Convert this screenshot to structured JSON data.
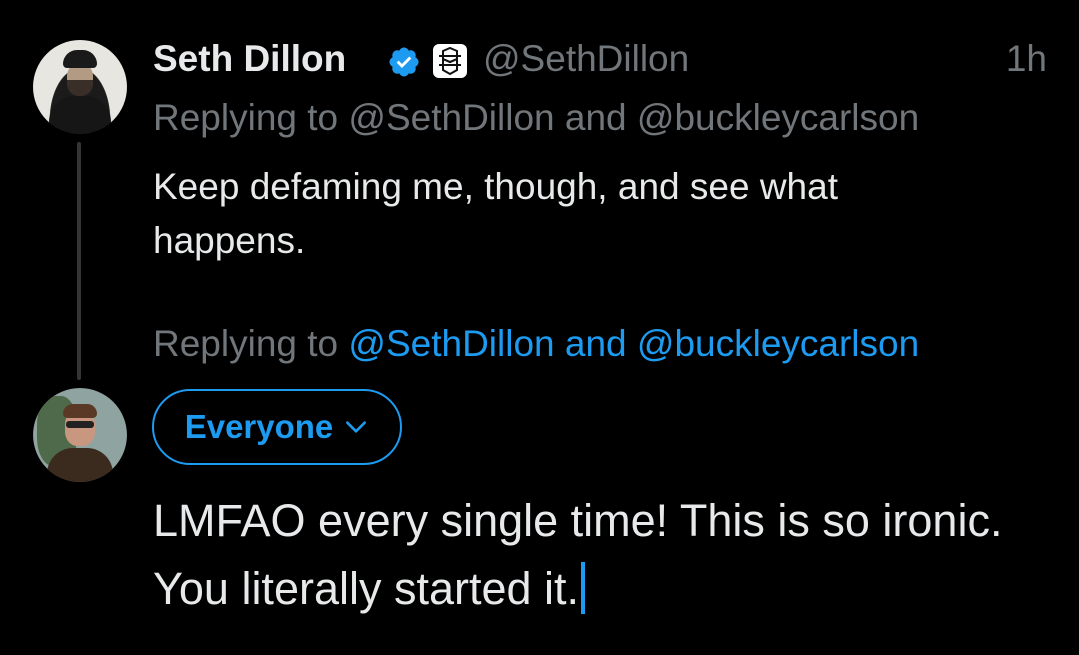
{
  "original_tweet": {
    "author_name": "Seth Dillon",
    "handle": "@SethDillon",
    "time": "1h",
    "replying_prefix": "Replying to",
    "replying_targets": "@SethDillon and @buckleycarlson",
    "text": "Keep defaming me, though, and see what happens."
  },
  "composer": {
    "replying_prefix": "Replying to",
    "replying_targets": "@SethDillon and @buckleycarlson",
    "audience_label": "Everyone",
    "draft_text": "LMFAO every single time! This is so ironic. You literally started it."
  },
  "icons": {
    "verified": "verified-badge-icon",
    "affiliate": "babylon-bee-affiliate-icon",
    "audience_chevron": "chevron-down-icon"
  },
  "colors": {
    "background": "#000000",
    "text_primary": "#e7e9ea",
    "text_secondary": "#71767b",
    "accent": "#1d9bf0"
  }
}
